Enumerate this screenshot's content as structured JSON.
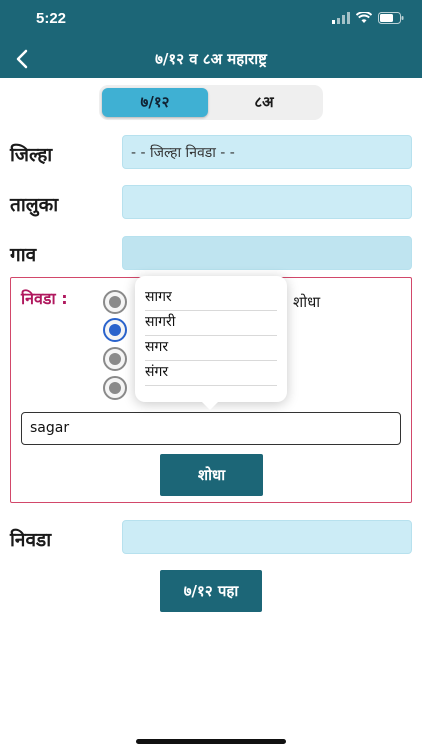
{
  "status_bar": {
    "time": "5:22"
  },
  "nav": {
    "title": "७/१२ व ८अ महाराष्ट्र"
  },
  "segments": [
    "७/१२",
    "८अ"
  ],
  "fields": {
    "district_label": "जिल्हा",
    "district_placeholder": "- - जिल्हा  निवडा - -",
    "taluka_label": "तालुका",
    "village_label": "गाव",
    "select_label": "निवडा"
  },
  "search_panel": {
    "label": "निवडा :",
    "hidden_option_text": "शोधा",
    "input_value": "sagar",
    "search_button": "शोधा"
  },
  "popover_options": [
    "सागर",
    "सागरी",
    "सगर",
    "संगर"
  ],
  "view_button": "७/१२ पहा",
  "colors": {
    "primary": "#1c6677",
    "accent": "#3fb0d3",
    "field_bg": "#ccecf6",
    "panel_border": "#d2476a",
    "panel_label": "#b0185e"
  }
}
